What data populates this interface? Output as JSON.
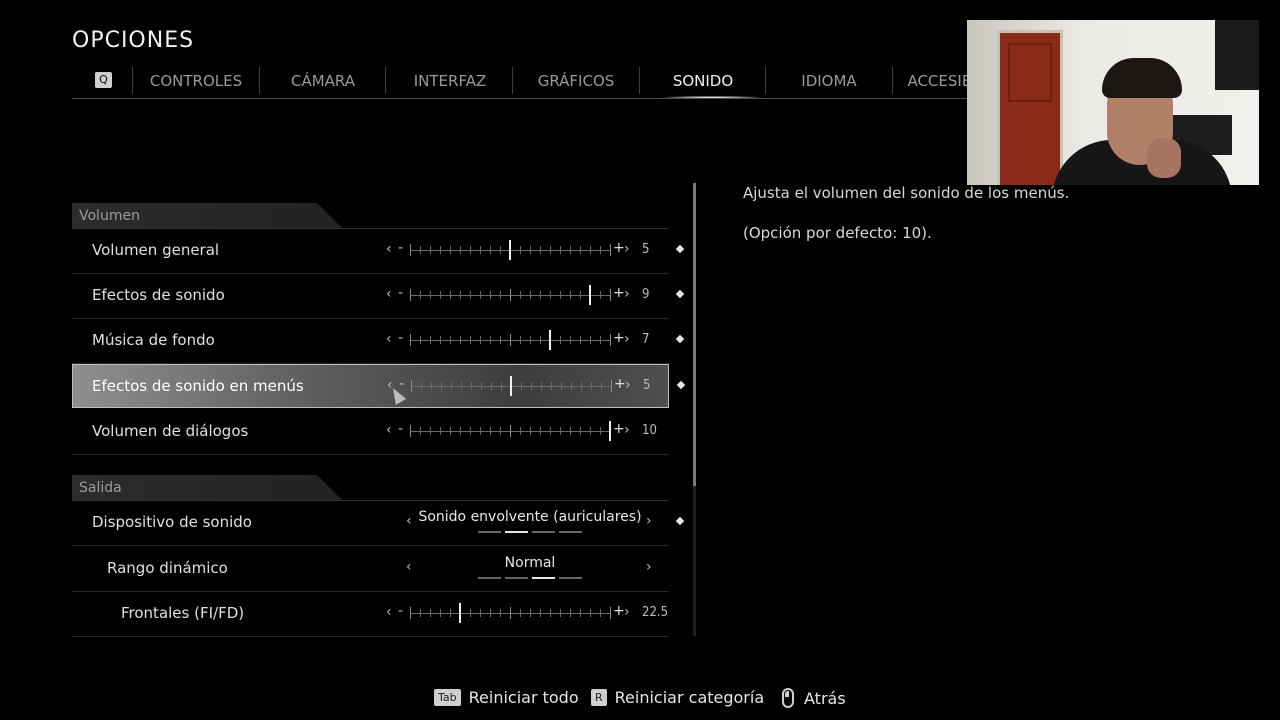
{
  "title": "OPCIONES",
  "tabs": {
    "key_left": "Q",
    "items": [
      "CONTROLES",
      "CÁMARA",
      "INTERFAZ",
      "GRÁFICOS",
      "SONIDO",
      "IDIOMA",
      "ACCESIBI"
    ],
    "active": "SONIDO"
  },
  "sections": {
    "volumen": "Volumen",
    "salida": "Salida"
  },
  "rows": [
    {
      "label": "Volumen general",
      "value": "5",
      "level": 5
    },
    {
      "label": "Efectos de sonido",
      "value": "9",
      "level": 9
    },
    {
      "label": "Música de fondo",
      "value": "7",
      "level": 7
    },
    {
      "label": "Efectos de sonido en menús",
      "value": "5",
      "level": 5
    },
    {
      "label": "Volumen de diálogos",
      "value": "10",
      "level": 10
    }
  ],
  "output": {
    "device": {
      "label": "Dispositivo de sonido",
      "value": "Sonido envolvente (auriculares)",
      "selected_index": 1,
      "options_count": 4
    },
    "dynamic_range": {
      "label": "Rango dinámico",
      "value": "Normal",
      "selected_index": 2,
      "options_count": 4
    },
    "front": {
      "label": "Frontales (FI/FD)",
      "value": "22.5",
      "level": 2.5
    }
  },
  "description": {
    "line1": "Ajusta el volumen del sonido de los menús.",
    "line2": "(Opción por defecto: 10)."
  },
  "footer": {
    "reset_all_key": "Tab",
    "reset_all": "Reiniciar todo",
    "reset_cat_key": "R",
    "reset_cat": "Reiniciar categoría",
    "back": "Atrás"
  },
  "slider_glyphs": {
    "left": "‹",
    "right": "›",
    "minus": "-",
    "plus": "+"
  }
}
